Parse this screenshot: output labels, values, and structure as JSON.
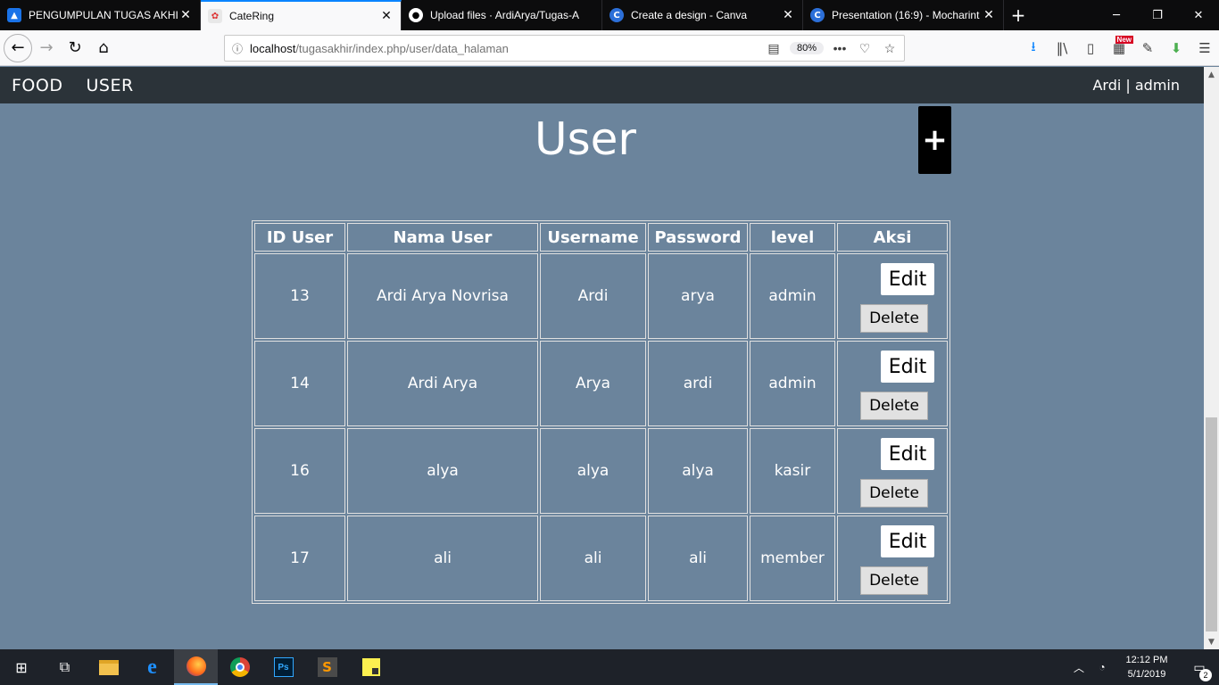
{
  "browser": {
    "tabs": [
      {
        "label": "PENGUMPULAN TUGAS AKHIR",
        "icon": "classroom-icon",
        "active": false
      },
      {
        "label": "CateRing",
        "icon": "catering-favicon-icon",
        "active": true
      },
      {
        "label": "Upload files · ArdiArya/Tugas-A",
        "icon": "github-icon",
        "active": false
      },
      {
        "label": "Create a design - Canva",
        "icon": "canva-icon",
        "active": false
      },
      {
        "label": "Presentation (16:9) - Mocharint",
        "icon": "canva-icon",
        "active": false
      }
    ],
    "url_host": "localhost",
    "url_path": "/tugasakhir/index.php/user/data_halaman",
    "zoom": "80%",
    "new_badge": "New"
  },
  "app": {
    "nav": {
      "food": "FOOD",
      "user": "USER",
      "user_info": "Ardi | admin"
    },
    "title": "User",
    "add_label": "+",
    "table": {
      "headers": [
        "ID User",
        "Nama User",
        "Username",
        "Password",
        "level",
        "Aksi"
      ],
      "rows": [
        {
          "id": "13",
          "nama": "Ardi Arya Novrisa",
          "username": "Ardi",
          "password": "arya",
          "level": "admin"
        },
        {
          "id": "14",
          "nama": "Ardi Arya",
          "username": "Arya",
          "password": "ardi",
          "level": "admin"
        },
        {
          "id": "16",
          "nama": "alya",
          "username": "alya",
          "password": "alya",
          "level": "kasir"
        },
        {
          "id": "17",
          "nama": "ali",
          "username": "ali",
          "password": "ali",
          "level": "member"
        }
      ],
      "edit_label": "Edit",
      "delete_label": "Delete"
    }
  },
  "taskbar": {
    "time": "12:12 PM",
    "date": "5/1/2019",
    "notification_count": "2"
  }
}
